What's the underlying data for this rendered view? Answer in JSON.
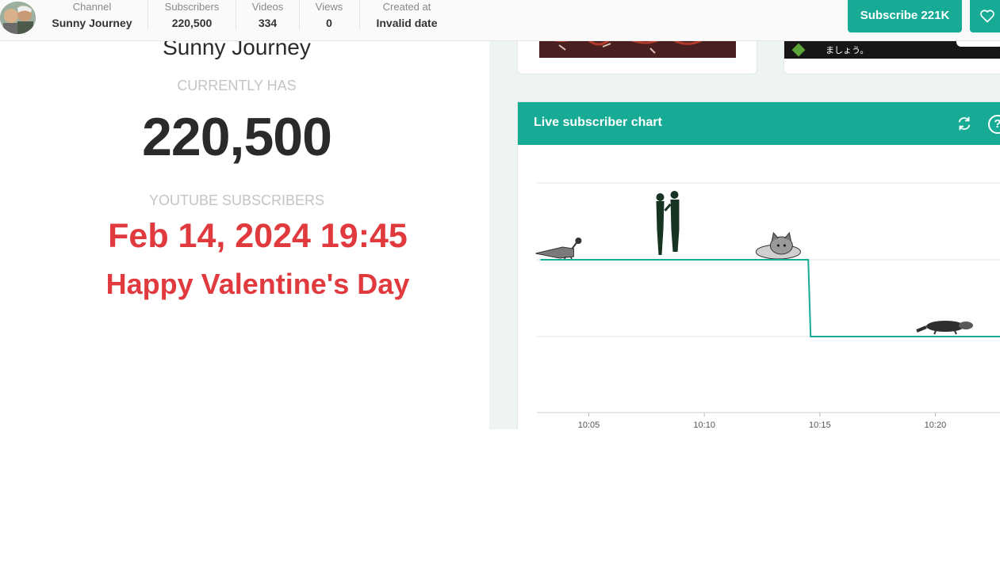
{
  "header": {
    "channel_label": "Channel",
    "channel_value": "Sunny Journey",
    "subscribers_label": "Subscribers",
    "subscribers_value": "220,500",
    "videos_label": "Videos",
    "videos_value": "334",
    "views_label": "Views",
    "views_value": "0",
    "created_label": "Created at",
    "created_value": "Invalid date",
    "subscribe_button": "Subscribe 221K",
    "heart_icon": "heart-icon"
  },
  "main": {
    "channel_name": "Sunny Journey",
    "currently_has": "CURRENTLY HAS",
    "count": "220,500",
    "youtube_subscribers": "YOUTUBE SUBSCRIBERS",
    "date_text": "Feb 14, 2024 19:45",
    "message": "Happy Valentine's Day"
  },
  "side": {
    "promo_text": "ましょう。"
  },
  "chart_card": {
    "title": "Live subscriber chart",
    "refresh_icon": "refresh-icon",
    "help_icon": "help-icon"
  },
  "chart_data": {
    "type": "line",
    "title": "Live subscriber chart",
    "x_tick_labels": [
      "10:05",
      "10:10",
      "10:15",
      "10:20"
    ],
    "x_tick_minutes": [
      5,
      10,
      15,
      20
    ],
    "xlim_minutes": [
      2.75,
      22.8
    ],
    "gridlines": 3,
    "grid": true,
    "series": [
      {
        "points": [
          {
            "t": 2.9,
            "level": 2
          },
          {
            "t": 14.5,
            "level": 2
          },
          {
            "t": 14.6,
            "level": 1
          },
          {
            "t": 22.8,
            "level": 1
          }
        ]
      }
    ],
    "decorations": [
      {
        "icon": "pheasant-icon",
        "t": 4
      },
      {
        "icon": "couple-silhouette-icon",
        "t": 8.5
      },
      {
        "icon": "cat-icon",
        "t": 13.2
      },
      {
        "icon": "ferret-icon",
        "t": 20.5
      }
    ],
    "line_color": "#17ab95"
  }
}
